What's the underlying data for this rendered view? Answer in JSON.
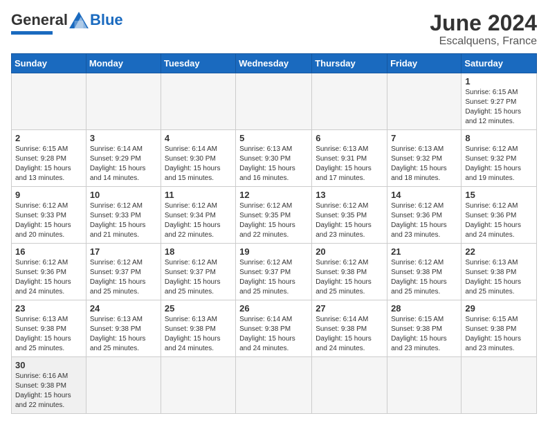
{
  "header": {
    "logo_general": "General",
    "logo_blue": "Blue",
    "month": "June 2024",
    "location": "Escalquens, France"
  },
  "weekdays": [
    "Sunday",
    "Monday",
    "Tuesday",
    "Wednesday",
    "Thursday",
    "Friday",
    "Saturday"
  ],
  "rows": [
    [
      {
        "day": "",
        "info": ""
      },
      {
        "day": "",
        "info": ""
      },
      {
        "day": "",
        "info": ""
      },
      {
        "day": "",
        "info": ""
      },
      {
        "day": "",
        "info": ""
      },
      {
        "day": "",
        "info": ""
      },
      {
        "day": "1",
        "info": "Sunrise: 6:15 AM\nSunset: 9:27 PM\nDaylight: 15 hours\nand 12 minutes."
      }
    ],
    [
      {
        "day": "2",
        "info": "Sunrise: 6:15 AM\nSunset: 9:28 PM\nDaylight: 15 hours\nand 13 minutes."
      },
      {
        "day": "3",
        "info": "Sunrise: 6:14 AM\nSunset: 9:29 PM\nDaylight: 15 hours\nand 14 minutes."
      },
      {
        "day": "4",
        "info": "Sunrise: 6:14 AM\nSunset: 9:30 PM\nDaylight: 15 hours\nand 15 minutes."
      },
      {
        "day": "5",
        "info": "Sunrise: 6:13 AM\nSunset: 9:30 PM\nDaylight: 15 hours\nand 16 minutes."
      },
      {
        "day": "6",
        "info": "Sunrise: 6:13 AM\nSunset: 9:31 PM\nDaylight: 15 hours\nand 17 minutes."
      },
      {
        "day": "7",
        "info": "Sunrise: 6:13 AM\nSunset: 9:32 PM\nDaylight: 15 hours\nand 18 minutes."
      },
      {
        "day": "8",
        "info": "Sunrise: 6:12 AM\nSunset: 9:32 PM\nDaylight: 15 hours\nand 19 minutes."
      }
    ],
    [
      {
        "day": "9",
        "info": "Sunrise: 6:12 AM\nSunset: 9:33 PM\nDaylight: 15 hours\nand 20 minutes."
      },
      {
        "day": "10",
        "info": "Sunrise: 6:12 AM\nSunset: 9:33 PM\nDaylight: 15 hours\nand 21 minutes."
      },
      {
        "day": "11",
        "info": "Sunrise: 6:12 AM\nSunset: 9:34 PM\nDaylight: 15 hours\nand 22 minutes."
      },
      {
        "day": "12",
        "info": "Sunrise: 6:12 AM\nSunset: 9:35 PM\nDaylight: 15 hours\nand 22 minutes."
      },
      {
        "day": "13",
        "info": "Sunrise: 6:12 AM\nSunset: 9:35 PM\nDaylight: 15 hours\nand 23 minutes."
      },
      {
        "day": "14",
        "info": "Sunrise: 6:12 AM\nSunset: 9:36 PM\nDaylight: 15 hours\nand 23 minutes."
      },
      {
        "day": "15",
        "info": "Sunrise: 6:12 AM\nSunset: 9:36 PM\nDaylight: 15 hours\nand 24 minutes."
      }
    ],
    [
      {
        "day": "16",
        "info": "Sunrise: 6:12 AM\nSunset: 9:36 PM\nDaylight: 15 hours\nand 24 minutes."
      },
      {
        "day": "17",
        "info": "Sunrise: 6:12 AM\nSunset: 9:37 PM\nDaylight: 15 hours\nand 25 minutes."
      },
      {
        "day": "18",
        "info": "Sunrise: 6:12 AM\nSunset: 9:37 PM\nDaylight: 15 hours\nand 25 minutes."
      },
      {
        "day": "19",
        "info": "Sunrise: 6:12 AM\nSunset: 9:37 PM\nDaylight: 15 hours\nand 25 minutes."
      },
      {
        "day": "20",
        "info": "Sunrise: 6:12 AM\nSunset: 9:38 PM\nDaylight: 15 hours\nand 25 minutes."
      },
      {
        "day": "21",
        "info": "Sunrise: 6:12 AM\nSunset: 9:38 PM\nDaylight: 15 hours\nand 25 minutes."
      },
      {
        "day": "22",
        "info": "Sunrise: 6:13 AM\nSunset: 9:38 PM\nDaylight: 15 hours\nand 25 minutes."
      }
    ],
    [
      {
        "day": "23",
        "info": "Sunrise: 6:13 AM\nSunset: 9:38 PM\nDaylight: 15 hours\nand 25 minutes."
      },
      {
        "day": "24",
        "info": "Sunrise: 6:13 AM\nSunset: 9:38 PM\nDaylight: 15 hours\nand 25 minutes."
      },
      {
        "day": "25",
        "info": "Sunrise: 6:13 AM\nSunset: 9:38 PM\nDaylight: 15 hours\nand 24 minutes."
      },
      {
        "day": "26",
        "info": "Sunrise: 6:14 AM\nSunset: 9:38 PM\nDaylight: 15 hours\nand 24 minutes."
      },
      {
        "day": "27",
        "info": "Sunrise: 6:14 AM\nSunset: 9:38 PM\nDaylight: 15 hours\nand 24 minutes."
      },
      {
        "day": "28",
        "info": "Sunrise: 6:15 AM\nSunset: 9:38 PM\nDaylight: 15 hours\nand 23 minutes."
      },
      {
        "day": "29",
        "info": "Sunrise: 6:15 AM\nSunset: 9:38 PM\nDaylight: 15 hours\nand 23 minutes."
      }
    ],
    [
      {
        "day": "30",
        "info": "Sunrise: 6:16 AM\nSunset: 9:38 PM\nDaylight: 15 hours\nand 22 minutes."
      },
      {
        "day": "",
        "info": ""
      },
      {
        "day": "",
        "info": ""
      },
      {
        "day": "",
        "info": ""
      },
      {
        "day": "",
        "info": ""
      },
      {
        "day": "",
        "info": ""
      },
      {
        "day": "",
        "info": ""
      }
    ]
  ]
}
